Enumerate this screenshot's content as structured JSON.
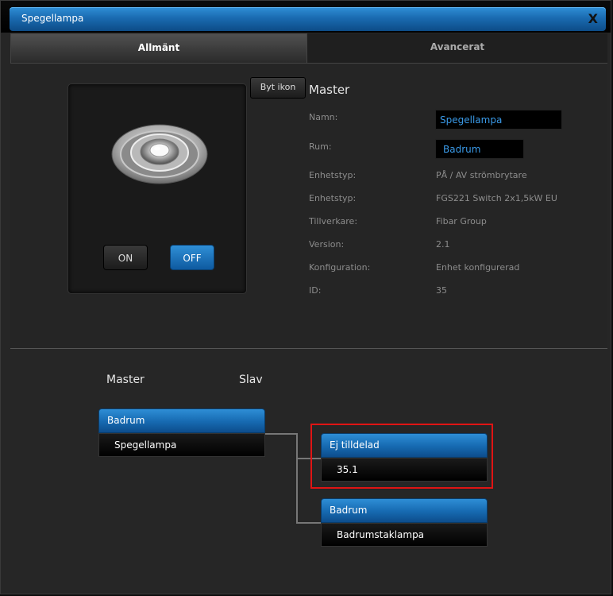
{
  "window": {
    "title": "Spegellampa",
    "close_label": "X"
  },
  "tabs": [
    {
      "label": "Allmänt",
      "active": true
    },
    {
      "label": "Avancerat",
      "active": false
    }
  ],
  "device": {
    "change_icon_label": "Byt ikon",
    "on_label": "ON",
    "off_label": "OFF",
    "state": "OFF"
  },
  "properties": {
    "heading": "Master",
    "name_label": "Namn:",
    "name_value": "Spegellampa",
    "room_label": "Rum:",
    "room_value": "Badrum",
    "rows": [
      {
        "label": "Enhetstyp:",
        "value": "PÅ / AV strömbrytare"
      },
      {
        "label": "Enhetstyp:",
        "value": "FGS221 Switch 2x1,5kW EU"
      },
      {
        "label": "Tillverkare:",
        "value": "Fibar Group"
      },
      {
        "label": "Version:",
        "value": "2.1"
      },
      {
        "label": "Konfiguration:",
        "value": "Enhet konfigurerad"
      },
      {
        "label": "ID:",
        "value": "35"
      }
    ]
  },
  "association": {
    "master_heading": "Master",
    "slave_heading": "Slav",
    "master": {
      "room": "Badrum",
      "name": "Spegellampa"
    },
    "slaves": [
      {
        "room": "Ej tilldelad",
        "name": "35.1",
        "highlighted": true
      },
      {
        "room": "Badrum",
        "name": "Badrumstaklampa",
        "highlighted": false
      }
    ]
  },
  "colors": {
    "accent": "#1a6bb1",
    "highlight": "#e01414",
    "input_text": "#3a9ae8"
  }
}
